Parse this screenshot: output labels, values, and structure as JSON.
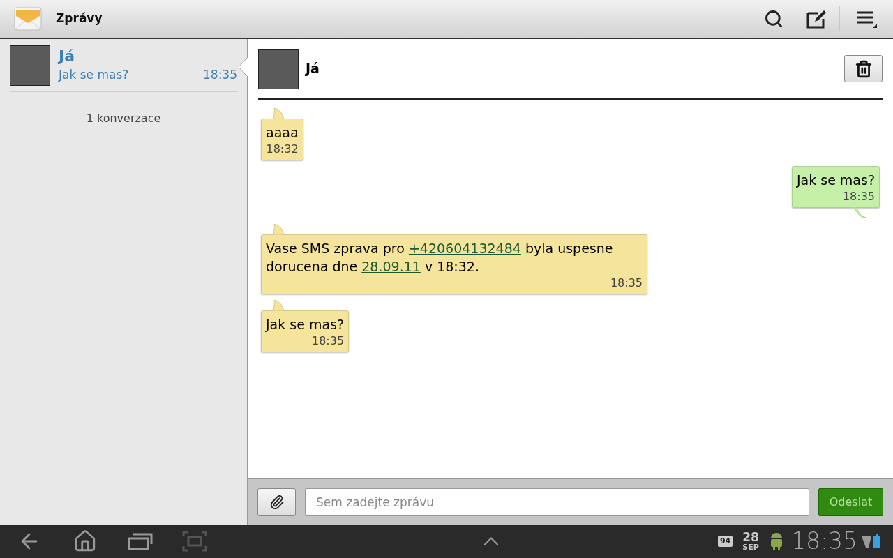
{
  "action_bar": {
    "title": "Zprávy"
  },
  "conversations": [
    {
      "name": "Já",
      "snippet": "Jak se mas?",
      "time": "18:35",
      "selected": true
    }
  ],
  "conversation_count": "1 konverzace",
  "thread": {
    "contact": "Já"
  },
  "messages": [
    {
      "kind": "incoming",
      "parts": [
        {
          "kind": "text",
          "text": "aaaa"
        }
      ],
      "time": "18:32"
    },
    {
      "kind": "outgoing",
      "parts": [
        {
          "kind": "text",
          "text": "Jak se mas?"
        }
      ],
      "time": "18:35"
    },
    {
      "kind": "incoming",
      "parts": [
        {
          "kind": "text",
          "text": "Vase SMS zprava pro "
        },
        {
          "kind": "link",
          "text": "+420604132484"
        },
        {
          "kind": "text",
          "text": " byla uspesne dorucena dne "
        },
        {
          "kind": "link",
          "text": "28.09.11"
        },
        {
          "kind": "text",
          "text": " v 18:32."
        }
      ],
      "time": "18:35"
    },
    {
      "kind": "incoming",
      "parts": [
        {
          "kind": "text",
          "text": "Jak se mas?"
        }
      ],
      "time": "18:35"
    }
  ],
  "composer": {
    "placeholder": "Sem zadejte zprávu",
    "send": "Odeslat"
  },
  "status_bar": {
    "notification": "94",
    "day": "28",
    "month": "SEP",
    "clock": "18:35"
  }
}
